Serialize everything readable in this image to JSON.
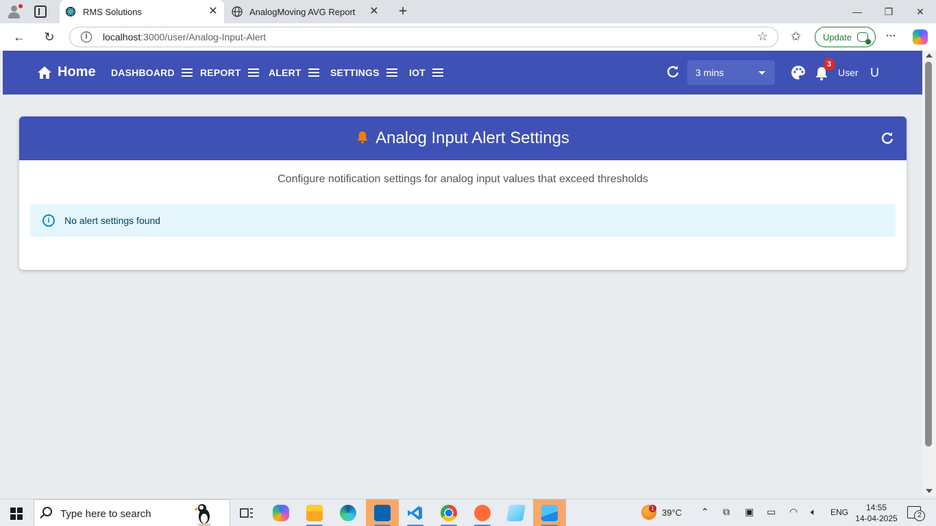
{
  "browser": {
    "tabs": [
      {
        "title": "RMS Solutions",
        "active": true
      },
      {
        "title": "AnalogMoving AVG Report",
        "active": false
      }
    ],
    "url_host": "localhost",
    "url_path": ":3000/user/Analog-Input-Alert",
    "update_label": "Update"
  },
  "navbar": {
    "home_label": "Home",
    "menu_items": [
      "DASHBOARD",
      "REPORT",
      "ALERT",
      "SETTINGS",
      "IOT"
    ],
    "refresh_interval": "3 mins",
    "notification_count": "3",
    "user_label": "User",
    "avatar_initial": "U",
    "brand_color": "#3f51b5"
  },
  "page": {
    "title": "Analog Input Alert Settings",
    "subtitle": "Configure notification settings for analog input values that exceed thresholds",
    "alert_message": "No alert settings found",
    "alert_bg": "#e5f6fd",
    "bell_color": "#f57c00"
  },
  "taskbar": {
    "search_placeholder": "Type here to search",
    "apps": [
      "task-view-icon",
      "copilot-icon",
      "file-explorer-icon",
      "edge-icon",
      "outlook-icon",
      "vscode-icon",
      "chrome-icon",
      "postman-icon",
      "notepad-icon",
      "photos-icon"
    ],
    "weather_alert_count": "1",
    "temperature": "39°C",
    "language": "ENG",
    "time": "14:55",
    "date": "14-04-2025",
    "notification_count": "2"
  }
}
